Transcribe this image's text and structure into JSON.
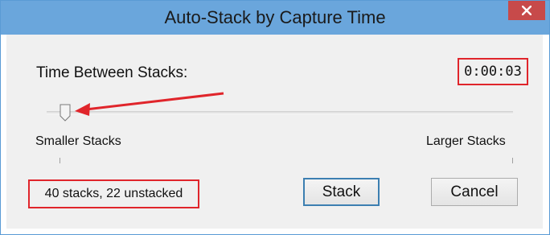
{
  "window": {
    "title": "Auto-Stack by Capture Time"
  },
  "controls": {
    "time_label": "Time Between Stacks:",
    "time_value": "0:00:03",
    "slider": {
      "min_label": "Smaller Stacks",
      "max_label": "Larger Stacks",
      "position_fraction": 0.04
    },
    "status": "40 stacks, 22 unstacked"
  },
  "buttons": {
    "stack": "Stack",
    "cancel": "Cancel"
  },
  "icons": {
    "close": "close-icon",
    "annotation_arrow": "arrow-icon"
  },
  "colors": {
    "titlebar": "#6aa6dc",
    "close_button": "#c74a4a",
    "highlight": "#e0252b",
    "default_button_border": "#3c7fb1",
    "dialog_background": "#f0f0f0"
  }
}
